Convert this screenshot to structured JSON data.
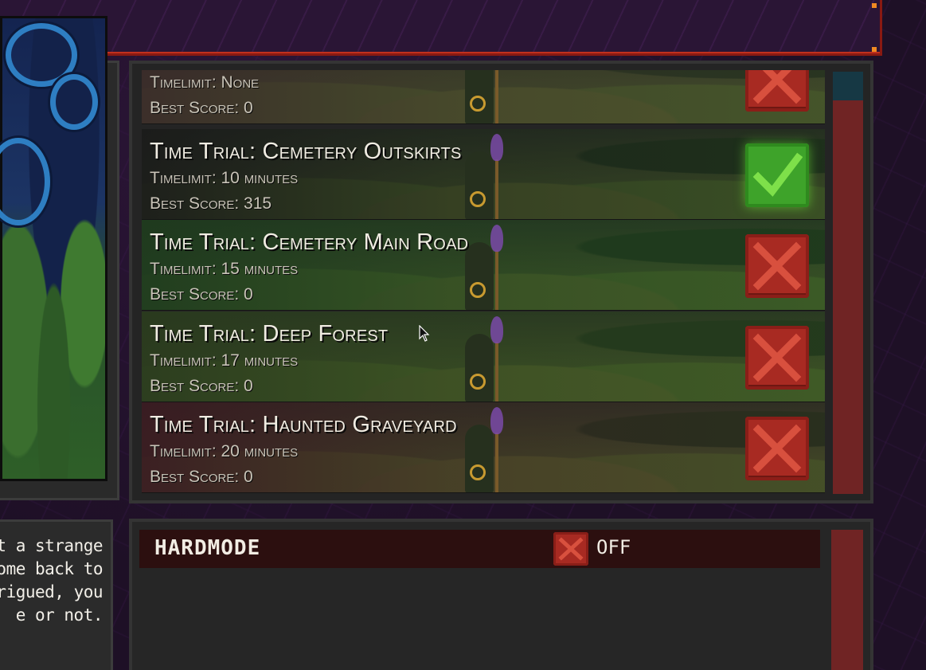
{
  "levels": [
    {
      "title": "",
      "timelimit": "Timelimit: None",
      "best_score": "Best Score: 0",
      "completed": false,
      "tint": "#3a2a2a"
    },
    {
      "title": "Time Trial: Cemetery Outskirts",
      "timelimit": "Timelimit: 10 minutes",
      "best_score": "Best Score: 315",
      "completed": true,
      "tint": "#1a1a1a"
    },
    {
      "title": "Time Trial: Cemetery Main Road",
      "timelimit": "Timelimit: 15 minutes",
      "best_score": "Best Score: 0",
      "completed": false,
      "tint": "#1e3a1e"
    },
    {
      "title": "Time Trial: Deep Forest",
      "timelimit": "Timelimit: 17 minutes",
      "best_score": "Best Score: 0",
      "completed": false,
      "tint": "#2a3a1e"
    },
    {
      "title": "Time Trial: Haunted Graveyard",
      "timelimit": "Timelimit: 20 minutes",
      "best_score": "Best Score: 0",
      "completed": false,
      "tint": "#3a1a22"
    }
  ],
  "description": "t a strange\nome back to\nrigued, you\ne or not.",
  "settings": {
    "hardmode_label": "HARDMODE",
    "hardmode_value": "OFF"
  },
  "colors": {
    "fail": "#a82a22",
    "pass": "#3ea32a",
    "scrollbar": "#702424",
    "accent_border": "#8a1a12"
  },
  "icons": {
    "fail": "x-mark-icon",
    "pass": "check-mark-icon"
  }
}
